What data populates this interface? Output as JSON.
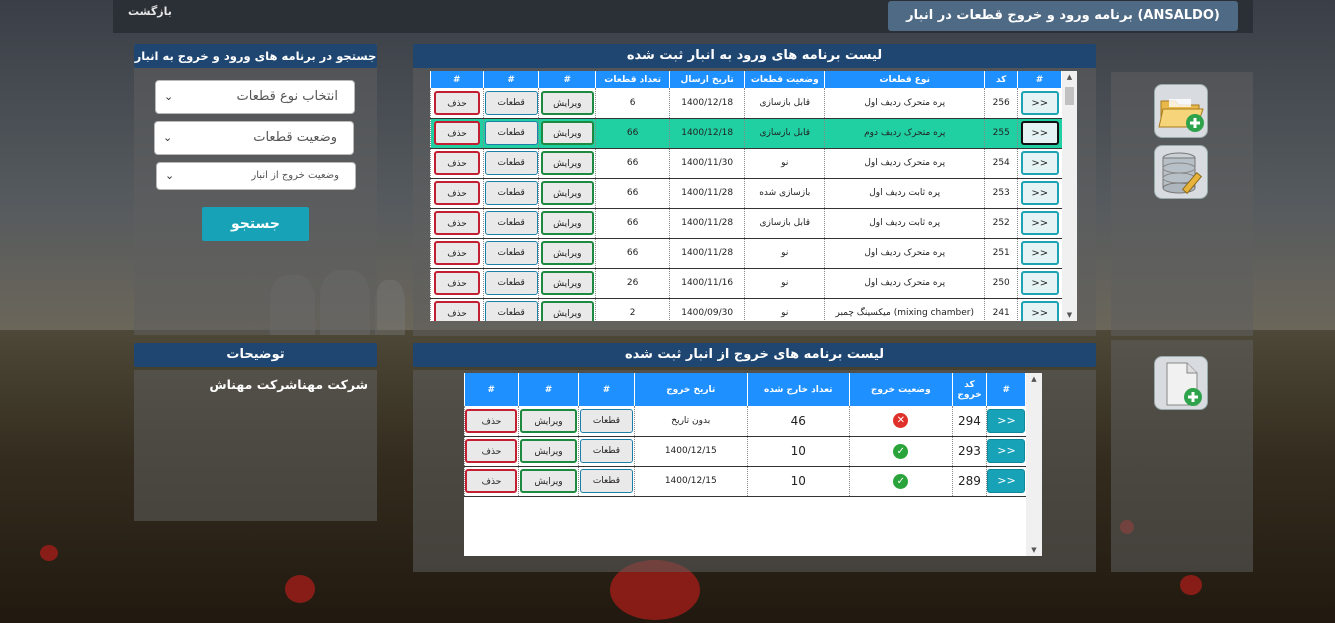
{
  "header": {
    "back_label": "بازگشت",
    "title": "برنامه ورود و خروج قطعات در انبار (ANSALDO)"
  },
  "search": {
    "header": "جستجو در برنامه های ورود و خروج به انبار",
    "part_type": "انتخاب نوع قطعات",
    "part_status": "وضعیت قطعات",
    "exit_status": "وضعیت خروج از انبار",
    "button": "جستجو"
  },
  "notes": {
    "header": "توضیحات",
    "text": "شرکت مهناشرکت مهناش"
  },
  "entry": {
    "header": "لیست برنامه های ورود به انبار ثبت شده",
    "columns": [
      "#",
      "کد",
      "نوع قطعات",
      "وضعیت قطعات",
      "تاریخ ارسال",
      "تعداد قطعات",
      "#",
      "#",
      "#"
    ],
    "rows": [
      {
        "go": ">>",
        "code": "256",
        "type": "پره متحرک ردیف اول",
        "status": "قابل بازسازی",
        "date": "1400/12/18",
        "count": "6",
        "edit": "ویرایش",
        "parts": "قطعات",
        "del": "حذف"
      },
      {
        "go": ">>",
        "code": "255",
        "type": "پره متحرک ردیف دوم",
        "status": "قابل بازسازی",
        "date": "1400/12/18",
        "count": "66",
        "edit": "ویرایش",
        "parts": "قطعات",
        "del": "حذف"
      },
      {
        "go": ">>",
        "code": "254",
        "type": "پره متحرک ردیف اول",
        "status": "نو",
        "date": "1400/11/30",
        "count": "66",
        "edit": "ویرایش",
        "parts": "قطعات",
        "del": "حذف"
      },
      {
        "go": ">>",
        "code": "253",
        "type": "پره ثابت ردیف اول",
        "status": "بازسازی شده",
        "date": "1400/11/28",
        "count": "66",
        "edit": "ویرایش",
        "parts": "قطعات",
        "del": "حذف"
      },
      {
        "go": ">>",
        "code": "252",
        "type": "پره ثابت ردیف اول",
        "status": "قابل بازسازی",
        "date": "1400/11/28",
        "count": "66",
        "edit": "ویرایش",
        "parts": "قطعات",
        "del": "حذف"
      },
      {
        "go": ">>",
        "code": "251",
        "type": "پره متحرک ردیف اول",
        "status": "نو",
        "date": "1400/11/28",
        "count": "66",
        "edit": "ویرایش",
        "parts": "قطعات",
        "del": "حذف"
      },
      {
        "go": ">>",
        "code": "250",
        "type": "پره متحرک ردیف اول",
        "status": "نو",
        "date": "1400/11/16",
        "count": "26",
        "edit": "ویرایش",
        "parts": "قطعات",
        "del": "حذف"
      },
      {
        "go": ">>",
        "code": "241",
        "type": "میکسینگ چمبر (mixing chamber)",
        "status": "نو",
        "date": "1400/09/30",
        "count": "2",
        "edit": "ویرایش",
        "parts": "قطعات",
        "del": "حذف"
      }
    ]
  },
  "exit": {
    "header": "لیست برنامه های خروج از انبار ثبت شده",
    "columns": [
      "#",
      "کد خروج",
      "وضعیت خروج",
      "تعداد خارج شده",
      "تاریخ خروج",
      "#",
      "#",
      "#"
    ],
    "rows": [
      {
        "go": ">>",
        "code": "294",
        "status_icon": "error-icon",
        "count": "46",
        "date": "بدون تاریخ",
        "parts": "قطعات",
        "edit": "ویرایش",
        "del": "حذف"
      },
      {
        "go": ">>",
        "code": "293",
        "status_icon": "check-icon",
        "count": "10",
        "date": "1400/12/15",
        "parts": "قطعات",
        "edit": "ویرایش",
        "del": "حذف"
      },
      {
        "go": ">>",
        "code": "289",
        "status_icon": "check-icon",
        "count": "10",
        "date": "1400/12/15",
        "parts": "قطعات",
        "edit": "ویرایش",
        "del": "حذف"
      }
    ]
  },
  "colors": {
    "header_blue": "#1f4670",
    "table_header": "#1e90ff",
    "highlight_row": "#21d0a2",
    "search_button": "#17a2b8"
  }
}
